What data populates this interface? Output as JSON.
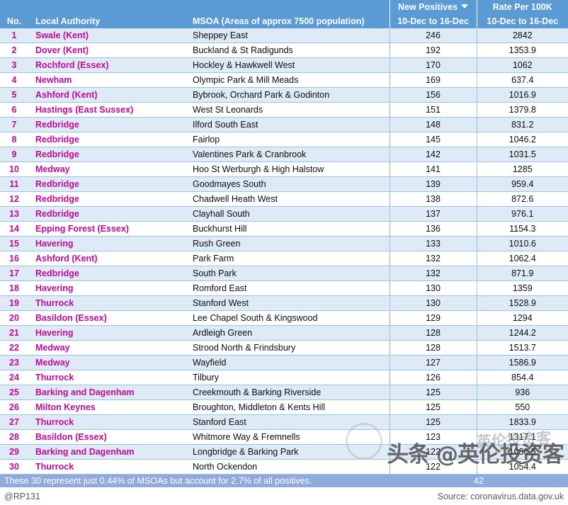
{
  "table": {
    "headers": {
      "no": "No.",
      "local_authority": "Local Authority",
      "msoa": "MSOA (Areas of approx 7500 population)",
      "new_positives_title": "New Positives",
      "new_positives_range": "10-Dec to 16-Dec",
      "rate_title": "Rate Per 100K",
      "rate_range": "10-Dec to 16-Dec",
      "sort_icon": "chevron-down-icon"
    },
    "rows": [
      {
        "no": "1",
        "la": "Swale (Kent)",
        "msoa": "Sheppey East",
        "pos": "246",
        "rate": "2842"
      },
      {
        "no": "2",
        "la": "Dover (Kent)",
        "msoa": "Buckland & St Radigunds",
        "pos": "192",
        "rate": "1353.9"
      },
      {
        "no": "3",
        "la": "Rochford (Essex)",
        "msoa": "Hockley & Hawkwell West",
        "pos": "170",
        "rate": "1062"
      },
      {
        "no": "4",
        "la": "Newham",
        "msoa": "Olympic Park & Mill Meads",
        "pos": "169",
        "rate": "637.4"
      },
      {
        "no": "5",
        "la": "Ashford (Kent)",
        "msoa": "Bybrook, Orchard Park & Godinton",
        "pos": "156",
        "rate": "1016.9"
      },
      {
        "no": "6",
        "la": "Hastings (East Sussex)",
        "msoa": "West St Leonards",
        "pos": "151",
        "rate": "1379.8"
      },
      {
        "no": "7",
        "la": "Redbridge",
        "msoa": "Ilford South East",
        "pos": "148",
        "rate": "831.2"
      },
      {
        "no": "8",
        "la": "Redbridge",
        "msoa": "Fairlop",
        "pos": "145",
        "rate": "1046.2"
      },
      {
        "no": "9",
        "la": "Redbridge",
        "msoa": "Valentines Park & Cranbrook",
        "pos": "142",
        "rate": "1031.5"
      },
      {
        "no": "10",
        "la": "Medway",
        "msoa": "Hoo St Werburgh & High Halstow",
        "pos": "141",
        "rate": "1285"
      },
      {
        "no": "11",
        "la": "Redbridge",
        "msoa": "Goodmayes South",
        "pos": "139",
        "rate": "959.4"
      },
      {
        "no": "12",
        "la": "Redbridge",
        "msoa": "Chadwell Heath West",
        "pos": "138",
        "rate": "872.6"
      },
      {
        "no": "13",
        "la": "Redbridge",
        "msoa": "Clayhall South",
        "pos": "137",
        "rate": "976.1"
      },
      {
        "no": "14",
        "la": "Epping Forest (Essex)",
        "msoa": "Buckhurst Hill",
        "pos": "136",
        "rate": "1154.3"
      },
      {
        "no": "15",
        "la": "Havering",
        "msoa": "Rush Green",
        "pos": "133",
        "rate": "1010.6"
      },
      {
        "no": "16",
        "la": "Ashford (Kent)",
        "msoa": "Park Farm",
        "pos": "132",
        "rate": "1062.4"
      },
      {
        "no": "17",
        "la": "Redbridge",
        "msoa": "South Park",
        "pos": "132",
        "rate": "871.9"
      },
      {
        "no": "18",
        "la": "Havering",
        "msoa": "Romford East",
        "pos": "130",
        "rate": "1359"
      },
      {
        "no": "19",
        "la": "Thurrock",
        "msoa": "Stanford West",
        "pos": "130",
        "rate": "1528.9"
      },
      {
        "no": "20",
        "la": "Basildon (Essex)",
        "msoa": "Lee Chapel South & Kingswood",
        "pos": "129",
        "rate": "1294"
      },
      {
        "no": "21",
        "la": "Havering",
        "msoa": "Ardleigh Green",
        "pos": "128",
        "rate": "1244.2"
      },
      {
        "no": "22",
        "la": "Medway",
        "msoa": "Strood North & Frindsbury",
        "pos": "128",
        "rate": "1513.7"
      },
      {
        "no": "23",
        "la": "Medway",
        "msoa": "Wayfield",
        "pos": "127",
        "rate": "1586.9"
      },
      {
        "no": "24",
        "la": "Thurrock",
        "msoa": "Tilbury",
        "pos": "126",
        "rate": "854.4"
      },
      {
        "no": "25",
        "la": "Barking and Dagenham",
        "msoa": "Creekmouth & Barking Riverside",
        "pos": "125",
        "rate": "936"
      },
      {
        "no": "26",
        "la": "Milton Keynes",
        "msoa": "Broughton, Middleton & Kents Hill",
        "pos": "125",
        "rate": "550"
      },
      {
        "no": "27",
        "la": "Thurrock",
        "msoa": "Stanford East",
        "pos": "125",
        "rate": "1833.9"
      },
      {
        "no": "28",
        "la": "Basildon (Essex)",
        "msoa": "Whitmore Way & Fremnells",
        "pos": "123",
        "rate": "1317.1"
      },
      {
        "no": "29",
        "la": "Barking and Dagenham",
        "msoa": "Longbridge & Barking Park",
        "pos": "122",
        "rate": "1080.5"
      },
      {
        "no": "30",
        "la": "Thurrock",
        "msoa": "North Ockendon",
        "pos": "122",
        "rate": "1054.4"
      }
    ]
  },
  "summary": {
    "text": "These 30 represent just 0.44% of MSOAs but account for 2.7% of all positives.",
    "total": "42"
  },
  "footer": {
    "handle": "@RP131",
    "source": "Source: coronavirus.data.gov.uk"
  },
  "watermark": {
    "main": "头条 @英伦投资客",
    "ghost": "英伦投资客"
  },
  "colors": {
    "header_blue": "#5B9BD5",
    "row_blue": "#DEEAF6",
    "row_white": "#FFFFFF",
    "magenta": "#C00A9B",
    "summary_blue": "#8FAADC",
    "grid_line": "#9DC3E6"
  }
}
